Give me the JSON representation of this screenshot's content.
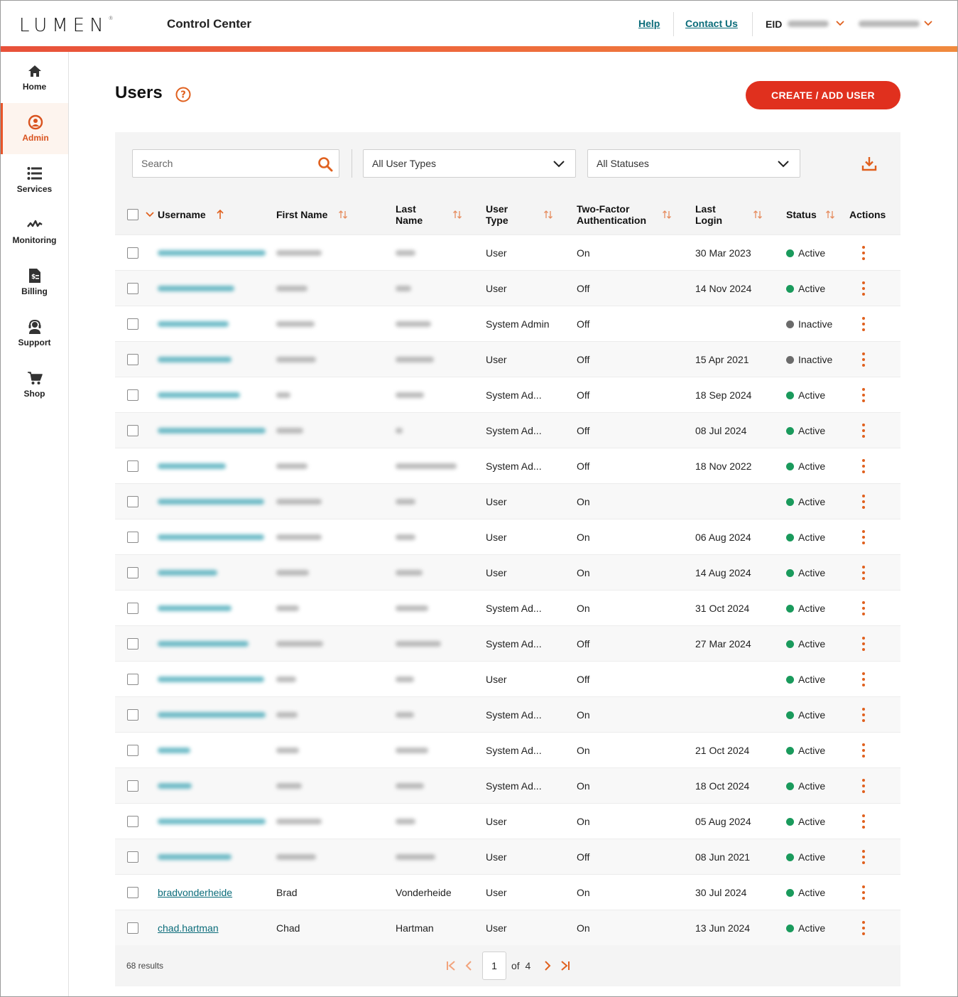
{
  "header": {
    "brand": "LUMEN",
    "brand_mark": "®",
    "app_title": "Control Center",
    "help_link": "Help",
    "contact_link": "Contact Us",
    "eid_label": "EID"
  },
  "sidebar": {
    "items": [
      {
        "label": "Home",
        "icon": "home-icon"
      },
      {
        "label": "Admin",
        "icon": "user-circle-icon",
        "active": true
      },
      {
        "label": "Services",
        "icon": "list-icon"
      },
      {
        "label": "Monitoring",
        "icon": "pulse-icon"
      },
      {
        "label": "Billing",
        "icon": "invoice-icon"
      },
      {
        "label": "Support",
        "icon": "support-agent-icon"
      },
      {
        "label": "Shop",
        "icon": "cart-icon"
      }
    ]
  },
  "page": {
    "title": "Users",
    "create_button": "CREATE / ADD USER"
  },
  "filters": {
    "search_placeholder": "Search",
    "user_type": "All User Types",
    "status": "All Statuses"
  },
  "table": {
    "columns": {
      "username": "Username",
      "first_name": "First Name",
      "last_name": "Last Name",
      "user_type": "User Type",
      "two_factor": "Two-Factor Authentication",
      "last_login": "Last Login",
      "status": "Status",
      "actions": "Actions"
    },
    "rows": [
      {
        "username": "",
        "first_name": "",
        "last_name": "",
        "user_type": "User",
        "two_factor": "On",
        "last_login": "30 Mar 2023",
        "status": "Active"
      },
      {
        "username": "",
        "first_name": "",
        "last_name": "",
        "user_type": "User",
        "two_factor": "Off",
        "last_login": "14 Nov 2024",
        "status": "Active"
      },
      {
        "username": "",
        "first_name": "",
        "last_name": "",
        "user_type": "System Admin",
        "two_factor": "Off",
        "last_login": "",
        "status": "Inactive"
      },
      {
        "username": "",
        "first_name": "",
        "last_name": "",
        "user_type": "User",
        "two_factor": "Off",
        "last_login": "15 Apr 2021",
        "status": "Inactive"
      },
      {
        "username": "",
        "first_name": "",
        "last_name": "",
        "user_type": "System Ad...",
        "two_factor": "Off",
        "last_login": "18 Sep 2024",
        "status": "Active"
      },
      {
        "username": "",
        "first_name": "",
        "last_name": "",
        "user_type": "System Ad...",
        "two_factor": "Off",
        "last_login": "08 Jul 2024",
        "status": "Active"
      },
      {
        "username": "",
        "first_name": "",
        "last_name": "",
        "user_type": "System Ad...",
        "two_factor": "Off",
        "last_login": "18 Nov 2022",
        "status": "Active"
      },
      {
        "username": "",
        "first_name": "",
        "last_name": "",
        "user_type": "User",
        "two_factor": "On",
        "last_login": "",
        "status": "Active"
      },
      {
        "username": "",
        "first_name": "",
        "last_name": "",
        "user_type": "User",
        "two_factor": "On",
        "last_login": "06 Aug 2024",
        "status": "Active"
      },
      {
        "username": "",
        "first_name": "",
        "last_name": "",
        "user_type": "User",
        "two_factor": "On",
        "last_login": "14 Aug 2024",
        "status": "Active"
      },
      {
        "username": "",
        "first_name": "",
        "last_name": "",
        "user_type": "System Ad...",
        "two_factor": "On",
        "last_login": "31 Oct 2024",
        "status": "Active"
      },
      {
        "username": "",
        "first_name": "",
        "last_name": "",
        "user_type": "System Ad...",
        "two_factor": "Off",
        "last_login": "27 Mar 2024",
        "status": "Active"
      },
      {
        "username": "",
        "first_name": "",
        "last_name": "",
        "user_type": "User",
        "two_factor": "Off",
        "last_login": "",
        "status": "Active"
      },
      {
        "username": "",
        "first_name": "",
        "last_name": "",
        "user_type": "System Ad...",
        "two_factor": "On",
        "last_login": "",
        "status": "Active"
      },
      {
        "username": "",
        "first_name": "",
        "last_name": "",
        "user_type": "System Ad...",
        "two_factor": "On",
        "last_login": "21 Oct 2024",
        "status": "Active"
      },
      {
        "username": "",
        "first_name": "",
        "last_name": "",
        "user_type": "System Ad...",
        "two_factor": "On",
        "last_login": "18 Oct 2024",
        "status": "Active"
      },
      {
        "username": "",
        "first_name": "",
        "last_name": "",
        "user_type": "User",
        "two_factor": "On",
        "last_login": "05 Aug 2024",
        "status": "Active"
      },
      {
        "username": "",
        "first_name": "",
        "last_name": "",
        "user_type": "User",
        "two_factor": "Off",
        "last_login": "08 Jun 2021",
        "status": "Active"
      },
      {
        "username": "bradvonderheide",
        "first_name": "Brad",
        "last_name": "Vonderheide",
        "user_type": "User",
        "two_factor": "On",
        "last_login": "30 Jul 2024",
        "status": "Active"
      },
      {
        "username": "chad.hartman",
        "first_name": "Chad",
        "last_name": "Hartman",
        "user_type": "User",
        "two_factor": "On",
        "last_login": "13 Jun 2024",
        "status": "Active"
      }
    ]
  },
  "pagination": {
    "results": "68 results",
    "current_page": "1",
    "of_label": "of",
    "total_pages": "4"
  },
  "colors": {
    "accent": "#e0301e",
    "link": "#0b6c7a",
    "active": "#1a9a5c",
    "inactive": "#6b6b6b",
    "icon_orange": "#e0601e"
  }
}
